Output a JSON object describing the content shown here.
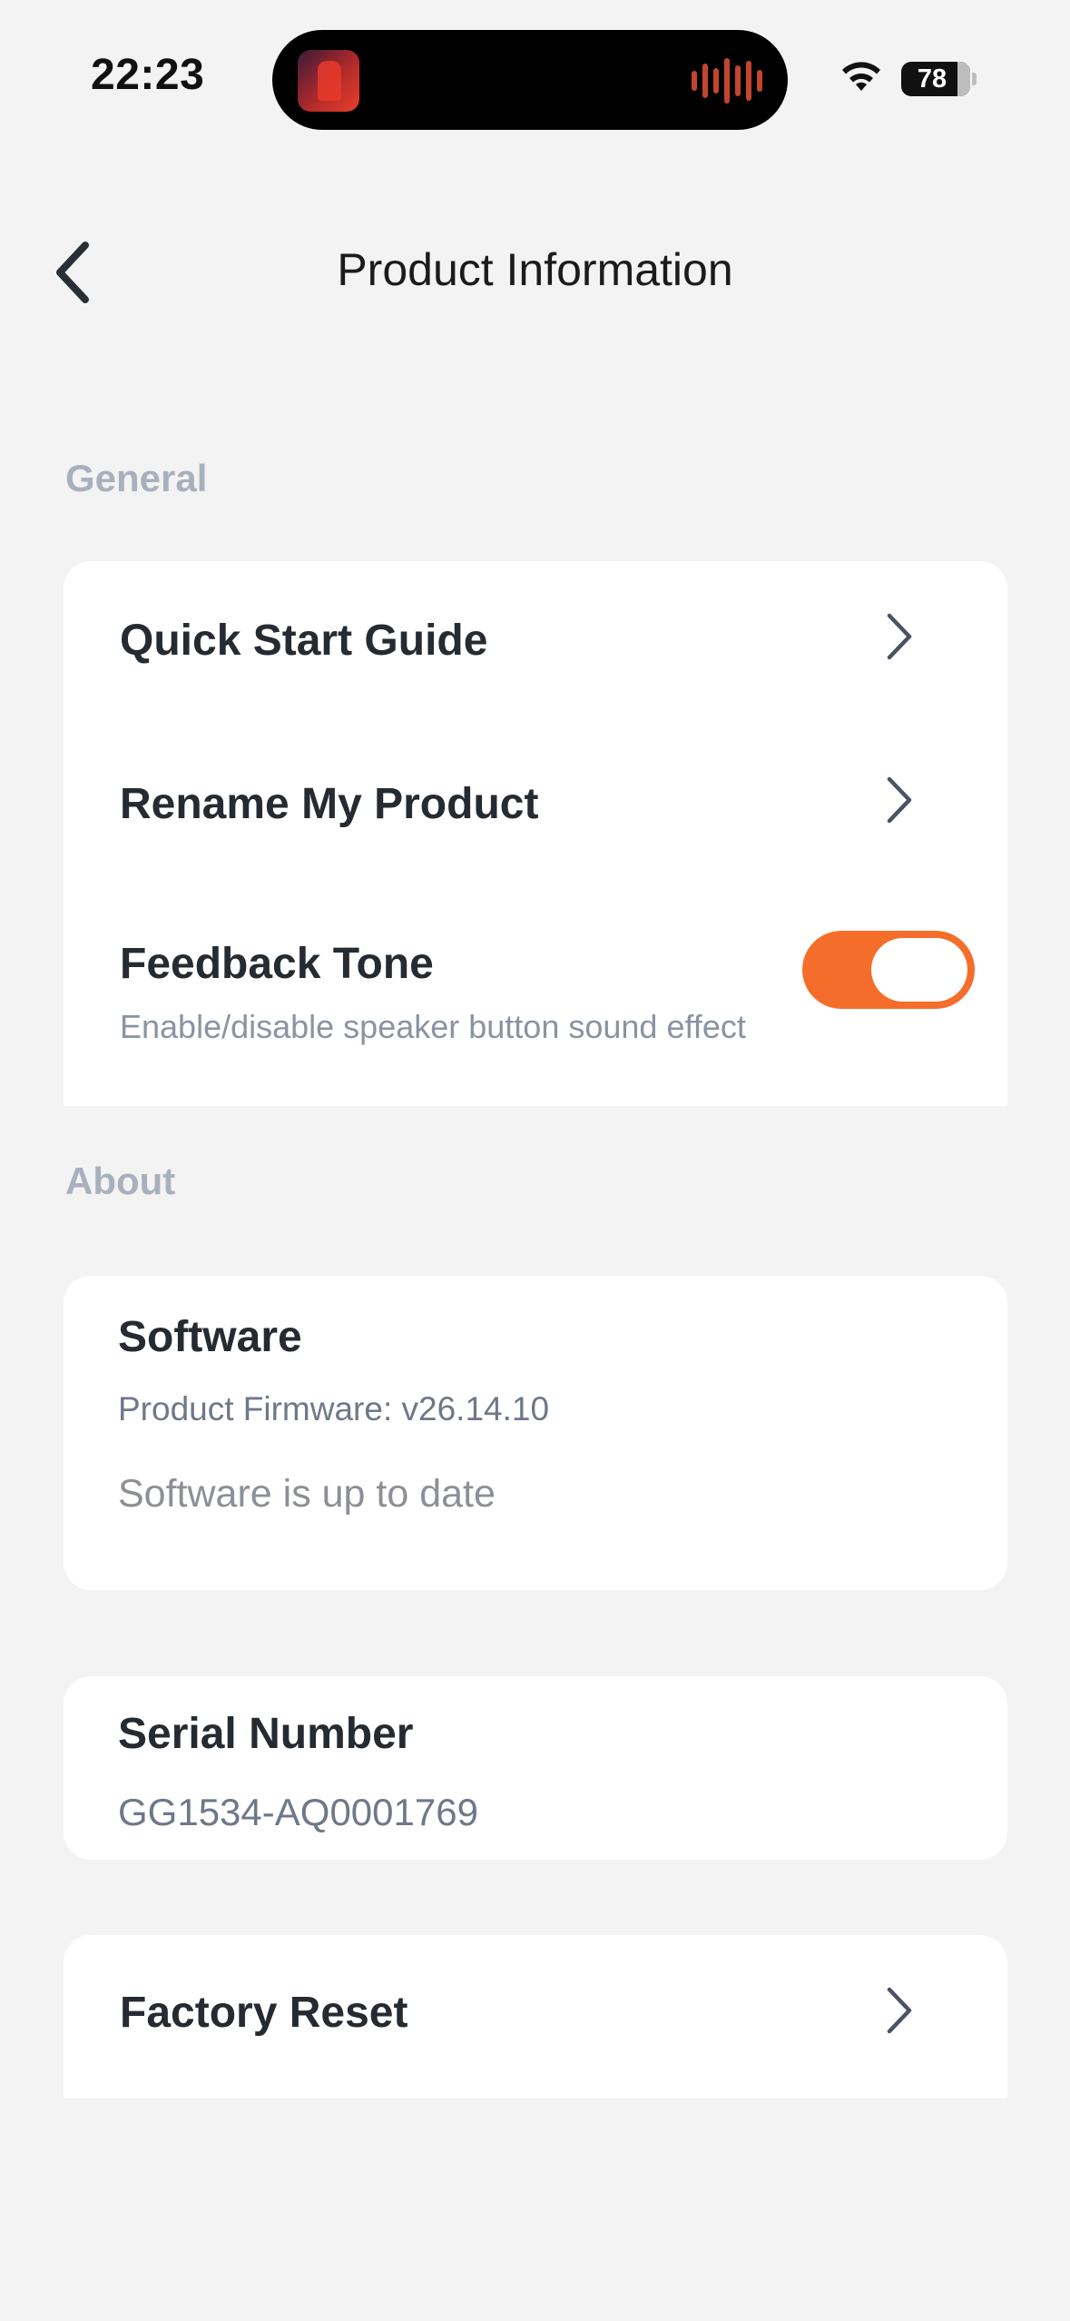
{
  "status_bar": {
    "time": "22:23",
    "battery": "78",
    "icons": [
      "now-playing-artwork",
      "audio-waveform-icon",
      "wifi-icon",
      "battery-icon"
    ]
  },
  "header": {
    "title": "Product Information",
    "back_icon": "chevron-left-icon"
  },
  "sections": {
    "general": {
      "label": "General"
    },
    "about": {
      "label": "About"
    }
  },
  "general_items": {
    "quick_start": {
      "label": "Quick Start Guide"
    },
    "rename": {
      "label": "Rename My Product"
    },
    "feedback_tone": {
      "label": "Feedback Tone",
      "description": "Enable/disable speaker button sound effect",
      "enabled": true
    }
  },
  "software": {
    "title": "Software",
    "firmware": "Product Firmware: v26.14.10",
    "status": "Software is up to date"
  },
  "serial": {
    "title": "Serial Number",
    "value": "GG1534-AQ0001769"
  },
  "factory_reset": {
    "label": "Factory Reset"
  },
  "colors": {
    "accent": "#f56d2a",
    "background": "#f3f3f3",
    "card": "#ffffff",
    "section_label": "#a9b0bd"
  }
}
